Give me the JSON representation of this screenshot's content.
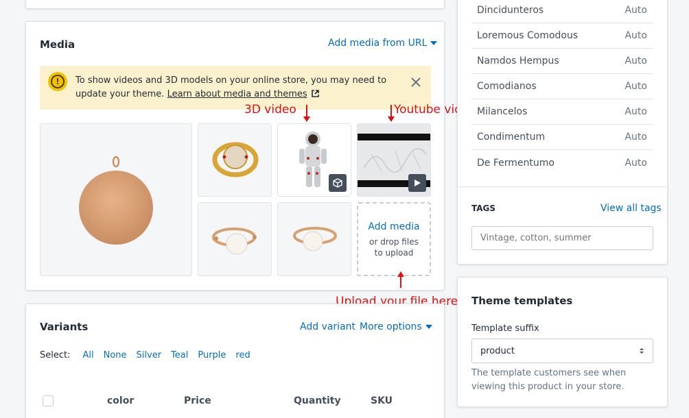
{
  "media": {
    "title": "Media",
    "add_from_url": "Add media from URL",
    "banner_text_1": "To show videos and 3D models on your online store, you may need to",
    "banner_text_2": "update your theme.",
    "banner_link": "Learn about media and themes",
    "add_media": "Add media",
    "drop_files": "or drop files to upload"
  },
  "annotations": {
    "video_3d": "3D video",
    "youtube": "Youtube video",
    "upload": "Upload your file here"
  },
  "variants": {
    "title": "Variants",
    "add_variant": "Add variant",
    "more_options": "More options",
    "select_label": "Select:",
    "filters": [
      "All",
      "None",
      "Silver",
      "Teal",
      "Purple",
      "red"
    ],
    "columns": {
      "color": "color",
      "price": "Price",
      "quantity": "Quantity",
      "sku": "SKU"
    }
  },
  "sales_channels": [
    {
      "name": "Dincidunteros",
      "status": "Auto"
    },
    {
      "name": "Loremous Comodous",
      "status": "Auto"
    },
    {
      "name": "Namdos Hempus",
      "status": "Auto"
    },
    {
      "name": "Comodianos",
      "status": "Auto"
    },
    {
      "name": "Milancelos",
      "status": "Auto"
    },
    {
      "name": "Condimentum",
      "status": "Auto"
    },
    {
      "name": "De Fermentumo",
      "status": "Auto"
    }
  ],
  "tags": {
    "label": "TAGS",
    "view_all": "View all tags",
    "placeholder": "Vintage, cotton, summer"
  },
  "theme": {
    "title": "Theme templates",
    "suffix_label": "Template suffix",
    "selected": "product",
    "help": "The template customers see when viewing this product in your store."
  },
  "colors": {
    "accent": "#006fbb",
    "annotation": "#e01010",
    "banner_bg": "#fcf1cd"
  }
}
